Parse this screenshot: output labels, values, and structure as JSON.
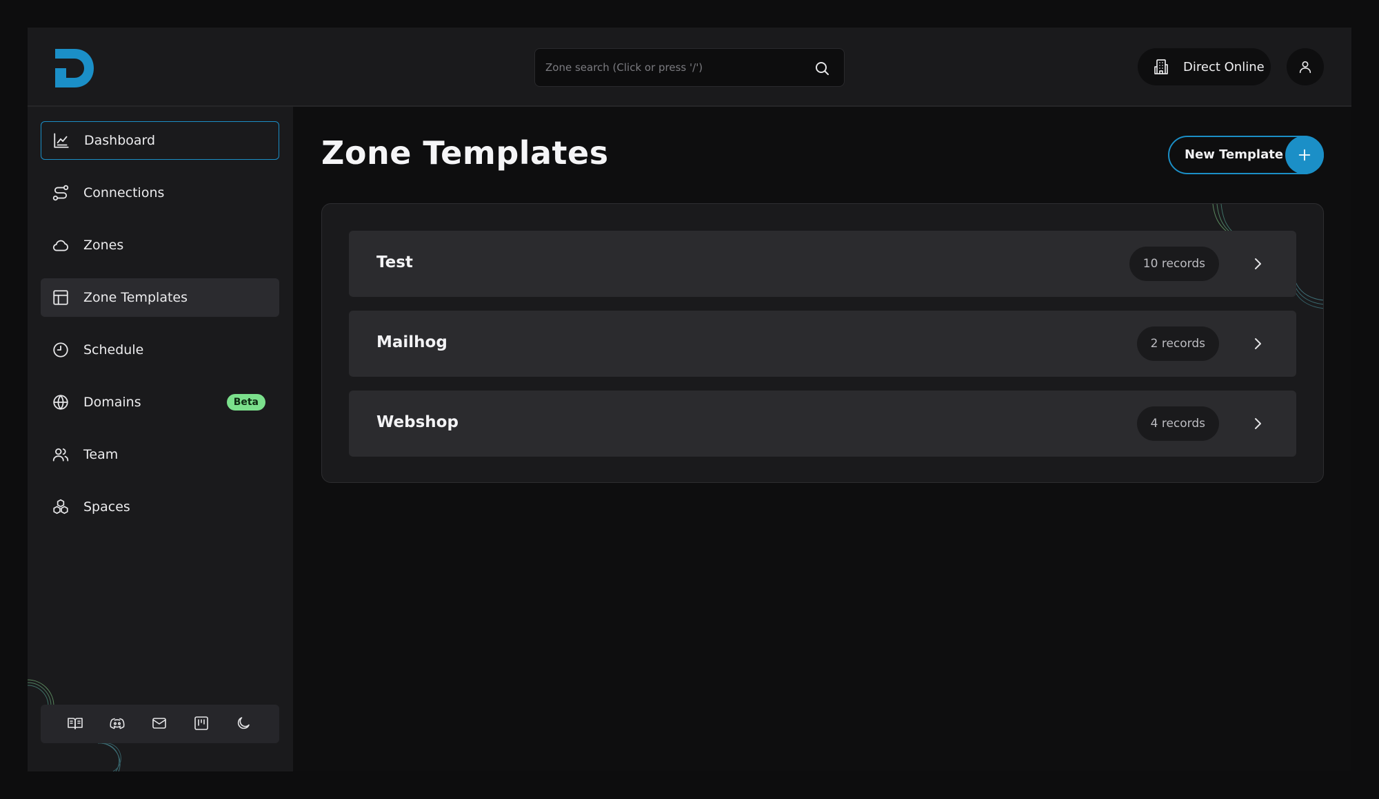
{
  "header": {
    "search": {
      "placeholder": "Zone search (Click or press '/')",
      "value": ""
    },
    "org_label": "Direct Online"
  },
  "sidebar": {
    "items": [
      {
        "label": "Dashboard",
        "icon": "chart-icon"
      },
      {
        "label": "Connections",
        "icon": "route-icon"
      },
      {
        "label": "Zones",
        "icon": "cloud-icon"
      },
      {
        "label": "Zone Templates",
        "icon": "layout-icon"
      },
      {
        "label": "Schedule",
        "icon": "clock-icon"
      },
      {
        "label": "Domains",
        "icon": "globe-icon",
        "badge": "Beta"
      },
      {
        "label": "Team",
        "icon": "users-icon"
      },
      {
        "label": "Spaces",
        "icon": "boxes-icon"
      }
    ],
    "footer_icons": [
      "book-icon",
      "discord-icon",
      "mail-icon",
      "kanban-icon",
      "moon-icon"
    ]
  },
  "main": {
    "title": "Zone Templates",
    "new_button_label": "New Template",
    "templates": [
      {
        "name": "Test",
        "records": "10 records"
      },
      {
        "name": "Mailhog",
        "records": "2 records"
      },
      {
        "name": "Webshop",
        "records": "4 records"
      }
    ]
  },
  "colors": {
    "accent": "#1b8fc7",
    "badge": "#7be08c",
    "background": "#0e0e0f",
    "surface": "#1a1a1c"
  }
}
